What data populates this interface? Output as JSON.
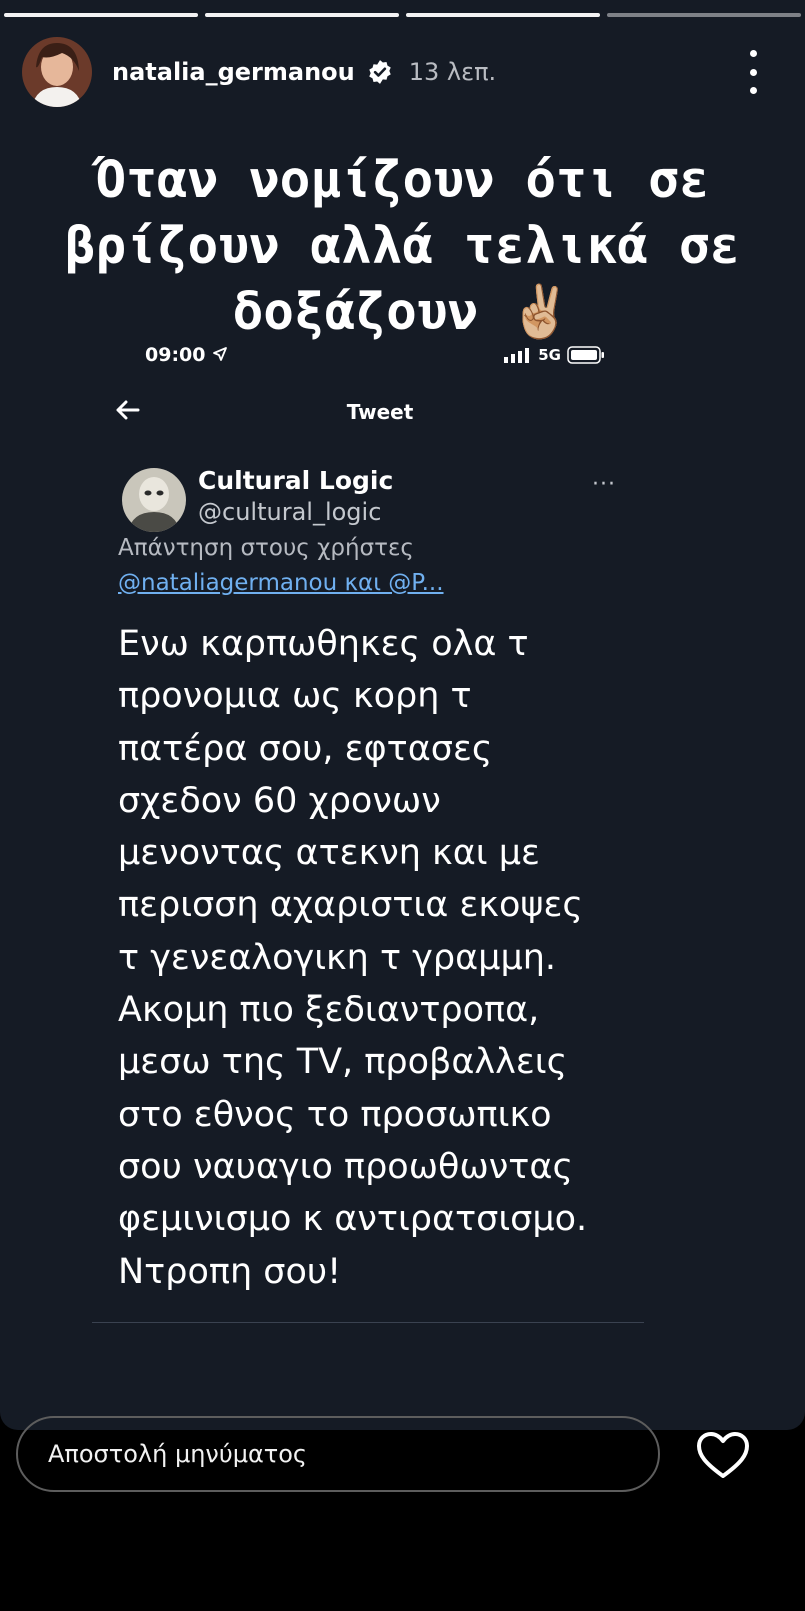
{
  "story": {
    "progress_segments": 4,
    "username": "natalia_germanou",
    "verified": true,
    "time_ago": "13 λεπ.",
    "caption": "Όταν νομίζουν ότι σε\nβρίζουν αλλά τελικά σε\nδοξάζουν ✌🏼"
  },
  "screenshot": {
    "status_time": "09:00",
    "network": "5G",
    "title": "Tweet"
  },
  "tweet": {
    "author_name": "Cultural Logic",
    "author_handle": "@cultural_logic",
    "more_label": "···",
    "reply_to_label": "Απάντηση στους χρήστες",
    "reply_to_users": "@nataliagermanou και @P...",
    "body": "Ενω καρπωθηκες ολα τ\nπρονομια ως κορη τ\nπατέρα σου, εφτασες\nσχεδον 60 χρονων\nμενοντας ατεκνη και με\nπερισση αχαριστια εκοψες\nτ γενεαλογικη τ γραμμη.\nΑκομη πιο ξεδιαντροπα,\nμεσω της TV, προβαλλεις\nστο εθνος το προσωπικο\nσου ναυαγιο προωθωντας\nφεμινισμο κ αντιρατσισμο.\nΝτροπη σου!"
  },
  "footer": {
    "message_placeholder": "Αποστολή μηνύματος"
  },
  "icons": {
    "verified": "verified-badge-icon",
    "more": "more-vertical-icon",
    "back": "arrow-left-icon",
    "heart": "heart-outline-icon",
    "location": "location-arrow-icon",
    "signal": "signal-bars-icon",
    "battery": "battery-icon"
  },
  "colors": {
    "story_background": "#151b25",
    "link": "#70b0f0",
    "footer_background": "#000000"
  }
}
